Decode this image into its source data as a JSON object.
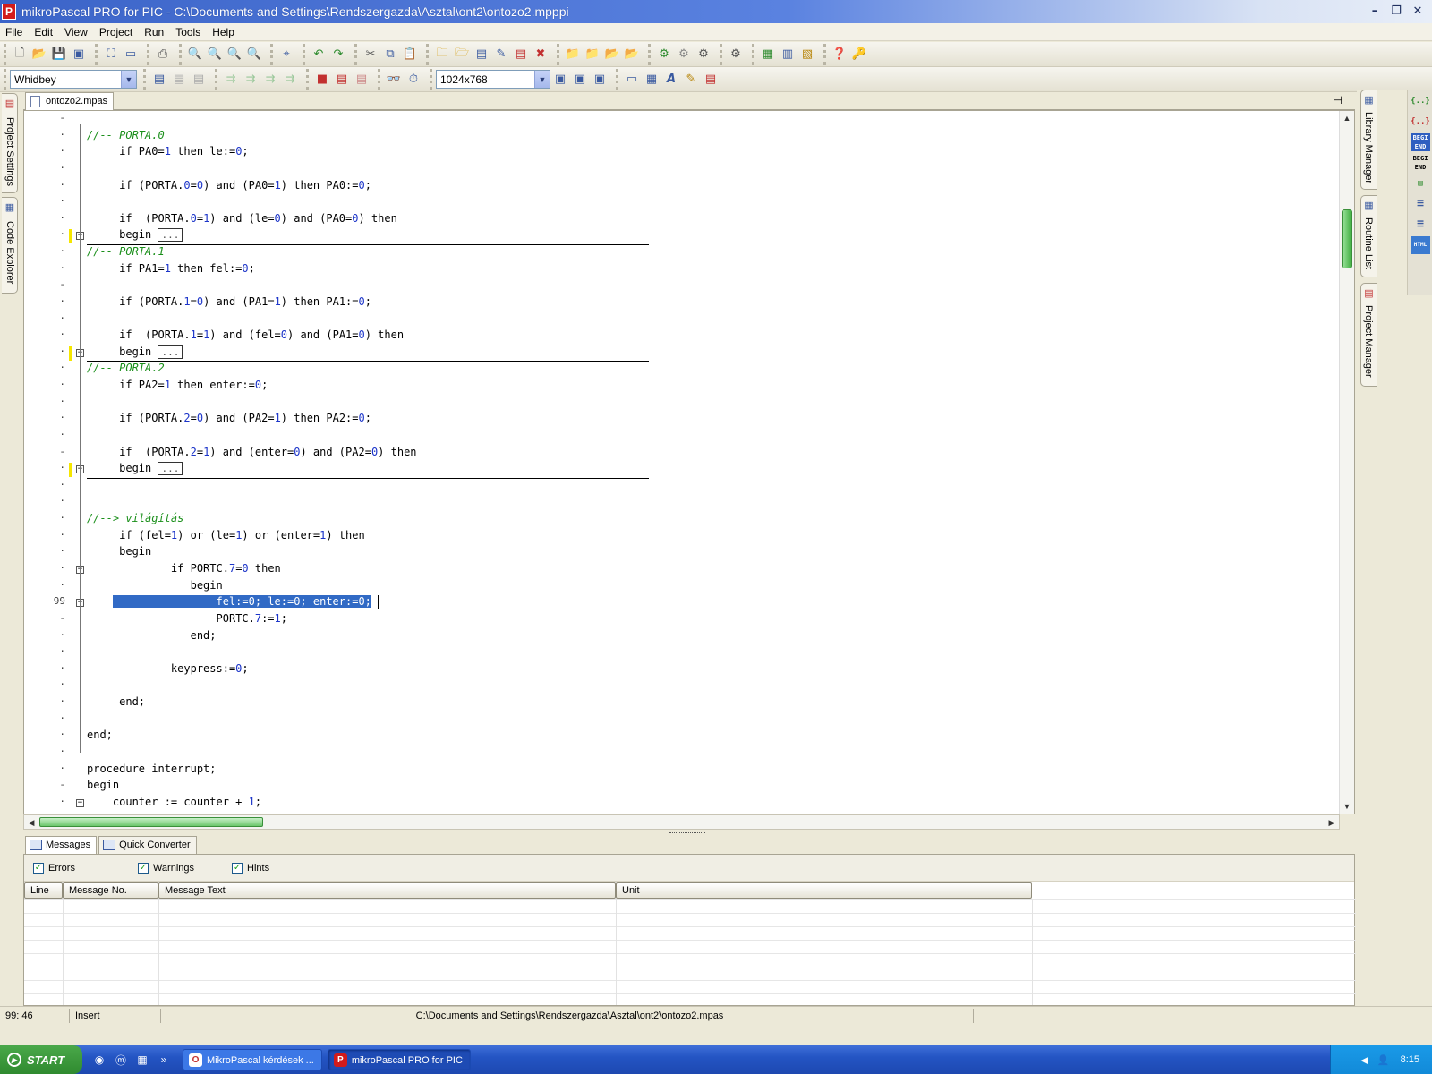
{
  "window": {
    "title": "mikroPascal PRO for PIC - C:\\Documents and Settings\\Rendszergazda\\Asztal\\ont2\\ontozo2.mpppi",
    "app_icon": "P"
  },
  "menu": [
    "File",
    "Edit",
    "View",
    "Project",
    "Run",
    "Tools",
    "Help"
  ],
  "toolbar2": {
    "scheme_value": "Whidbey",
    "resolution_value": "1024x768"
  },
  "left_dock": {
    "tabs": [
      "Project Settings",
      "Code Explorer"
    ]
  },
  "right_dock": {
    "tabs": [
      "Library Manager",
      "Routine List",
      "Project Manager"
    ]
  },
  "editor": {
    "file_tab": "ontozo2.mpas",
    "current_line_number": "99",
    "collapsed_marker": "...",
    "lines": [
      {
        "tokens": []
      },
      {
        "tokens": [
          {
            "t": "//-- PORTA.0",
            "c": "cmt"
          }
        ]
      },
      {
        "tokens": [
          {
            "t": "     if PA0="
          },
          {
            "t": "1",
            "c": "num"
          },
          {
            "t": " then le:="
          },
          {
            "t": "0",
            "c": "num"
          },
          {
            "t": ";"
          }
        ]
      },
      {
        "tokens": []
      },
      {
        "tokens": [
          {
            "t": "     if (PORTA."
          },
          {
            "t": "0",
            "c": "num"
          },
          {
            "t": "="
          },
          {
            "t": "0",
            "c": "num"
          },
          {
            "t": ") and (PA0="
          },
          {
            "t": "1",
            "c": "num"
          },
          {
            "t": ") then PA0:="
          },
          {
            "t": "0",
            "c": "num"
          },
          {
            "t": ";"
          }
        ]
      },
      {
        "tokens": []
      },
      {
        "tokens": [
          {
            "t": "     if  (PORTA."
          },
          {
            "t": "0",
            "c": "num"
          },
          {
            "t": "="
          },
          {
            "t": "1",
            "c": "num"
          },
          {
            "t": ") and (le="
          },
          {
            "t": "0",
            "c": "num"
          },
          {
            "t": ") and (PA0="
          },
          {
            "t": "0",
            "c": "num"
          },
          {
            "t": ") then"
          }
        ]
      },
      {
        "tokens": [
          {
            "t": "     begin "
          },
          {
            "t": "...",
            "c": "collapsed"
          }
        ]
      },
      {
        "tokens": [
          {
            "t": "//-- PORTA.1",
            "c": "cmt"
          }
        ]
      },
      {
        "tokens": [
          {
            "t": "     if PA1="
          },
          {
            "t": "1",
            "c": "num"
          },
          {
            "t": " then fel:="
          },
          {
            "t": "0",
            "c": "num"
          },
          {
            "t": ";"
          }
        ]
      },
      {
        "tokens": []
      },
      {
        "tokens": [
          {
            "t": "     if (PORTA."
          },
          {
            "t": "1",
            "c": "num"
          },
          {
            "t": "="
          },
          {
            "t": "0",
            "c": "num"
          },
          {
            "t": ") and (PA1="
          },
          {
            "t": "1",
            "c": "num"
          },
          {
            "t": ") then PA1:="
          },
          {
            "t": "0",
            "c": "num"
          },
          {
            "t": ";"
          }
        ]
      },
      {
        "tokens": []
      },
      {
        "tokens": [
          {
            "t": "     if  (PORTA."
          },
          {
            "t": "1",
            "c": "num"
          },
          {
            "t": "="
          },
          {
            "t": "1",
            "c": "num"
          },
          {
            "t": ") and (fel="
          },
          {
            "t": "0",
            "c": "num"
          },
          {
            "t": ") and (PA1="
          },
          {
            "t": "0",
            "c": "num"
          },
          {
            "t": ") then"
          }
        ]
      },
      {
        "tokens": [
          {
            "t": "     begin "
          },
          {
            "t": "...",
            "c": "collapsed"
          }
        ]
      },
      {
        "tokens": [
          {
            "t": "//-- PORTA.2",
            "c": "cmt"
          }
        ]
      },
      {
        "tokens": [
          {
            "t": "     if PA2="
          },
          {
            "t": "1",
            "c": "num"
          },
          {
            "t": " then enter:="
          },
          {
            "t": "0",
            "c": "num"
          },
          {
            "t": ";"
          }
        ]
      },
      {
        "tokens": []
      },
      {
        "tokens": [
          {
            "t": "     if (PORTA."
          },
          {
            "t": "2",
            "c": "num"
          },
          {
            "t": "="
          },
          {
            "t": "0",
            "c": "num"
          },
          {
            "t": ") and (PA2="
          },
          {
            "t": "1",
            "c": "num"
          },
          {
            "t": ") then PA2:="
          },
          {
            "t": "0",
            "c": "num"
          },
          {
            "t": ";"
          }
        ]
      },
      {
        "tokens": []
      },
      {
        "tokens": [
          {
            "t": "     if  (PORTA."
          },
          {
            "t": "2",
            "c": "num"
          },
          {
            "t": "="
          },
          {
            "t": "1",
            "c": "num"
          },
          {
            "t": ") and (enter="
          },
          {
            "t": "0",
            "c": "num"
          },
          {
            "t": ") and (PA2="
          },
          {
            "t": "0",
            "c": "num"
          },
          {
            "t": ") then"
          }
        ]
      },
      {
        "tokens": [
          {
            "t": "     begin "
          },
          {
            "t": "...",
            "c": "collapsed"
          }
        ]
      },
      {
        "tokens": []
      },
      {
        "tokens": []
      },
      {
        "tokens": [
          {
            "t": "//--> világítás",
            "c": "cmt"
          }
        ]
      },
      {
        "tokens": [
          {
            "t": "     if (fel="
          },
          {
            "t": "1",
            "c": "num"
          },
          {
            "t": ") or (le="
          },
          {
            "t": "1",
            "c": "num"
          },
          {
            "t": ") or (enter="
          },
          {
            "t": "1",
            "c": "num"
          },
          {
            "t": ") then"
          }
        ]
      },
      {
        "tokens": [
          {
            "t": "     begin"
          }
        ]
      },
      {
        "tokens": [
          {
            "t": "             if PORTC."
          },
          {
            "t": "7",
            "c": "num"
          },
          {
            "t": "="
          },
          {
            "t": "0",
            "c": "num"
          },
          {
            "t": " then"
          }
        ]
      },
      {
        "tokens": [
          {
            "t": "                begin"
          }
        ]
      },
      {
        "tokens": [
          {
            "t": "    "
          },
          {
            "t": "                fel:=0; le:=0; enter:=0;",
            "c": "sel"
          }
        ]
      },
      {
        "tokens": [
          {
            "t": "                    PORTC."
          },
          {
            "t": "7",
            "c": "num"
          },
          {
            "t": ":="
          },
          {
            "t": "1",
            "c": "num"
          },
          {
            "t": ";"
          }
        ]
      },
      {
        "tokens": [
          {
            "t": "                end;"
          }
        ]
      },
      {
        "tokens": []
      },
      {
        "tokens": [
          {
            "t": "             keypress:="
          },
          {
            "t": "0",
            "c": "num"
          },
          {
            "t": ";"
          }
        ]
      },
      {
        "tokens": []
      },
      {
        "tokens": [
          {
            "t": "     end;"
          }
        ]
      },
      {
        "tokens": []
      },
      {
        "tokens": [
          {
            "t": "end;"
          }
        ]
      },
      {
        "tokens": []
      },
      {
        "tokens": [
          {
            "t": "procedure interrupt;"
          }
        ]
      },
      {
        "tokens": [
          {
            "t": "begin"
          }
        ]
      },
      {
        "tokens": [
          {
            "t": "    counter := counter + "
          },
          {
            "t": "1",
            "c": "num"
          },
          {
            "t": ";"
          }
        ]
      }
    ]
  },
  "messages": {
    "tabs": [
      "Messages",
      "Quick Converter"
    ],
    "filters": [
      "Errors",
      "Warnings",
      "Hints"
    ],
    "columns": [
      "Line",
      "Message No.",
      "Message Text",
      "Unit"
    ]
  },
  "status_bar": {
    "position": "99: 46",
    "mode": "Insert",
    "file_path": "C:\\Documents and Settings\\Rendszergazda\\Asztal\\ont2\\ontozo2.mpas"
  },
  "taskbar": {
    "start_label": "START",
    "tasks": [
      {
        "label": "MikroPascal kérdések ...",
        "icon": "opera-icon",
        "active": false
      },
      {
        "label": "mikroPascal PRO for PIC",
        "icon": "mikropascal-icon",
        "active": true
      }
    ],
    "clock": "8:15"
  }
}
